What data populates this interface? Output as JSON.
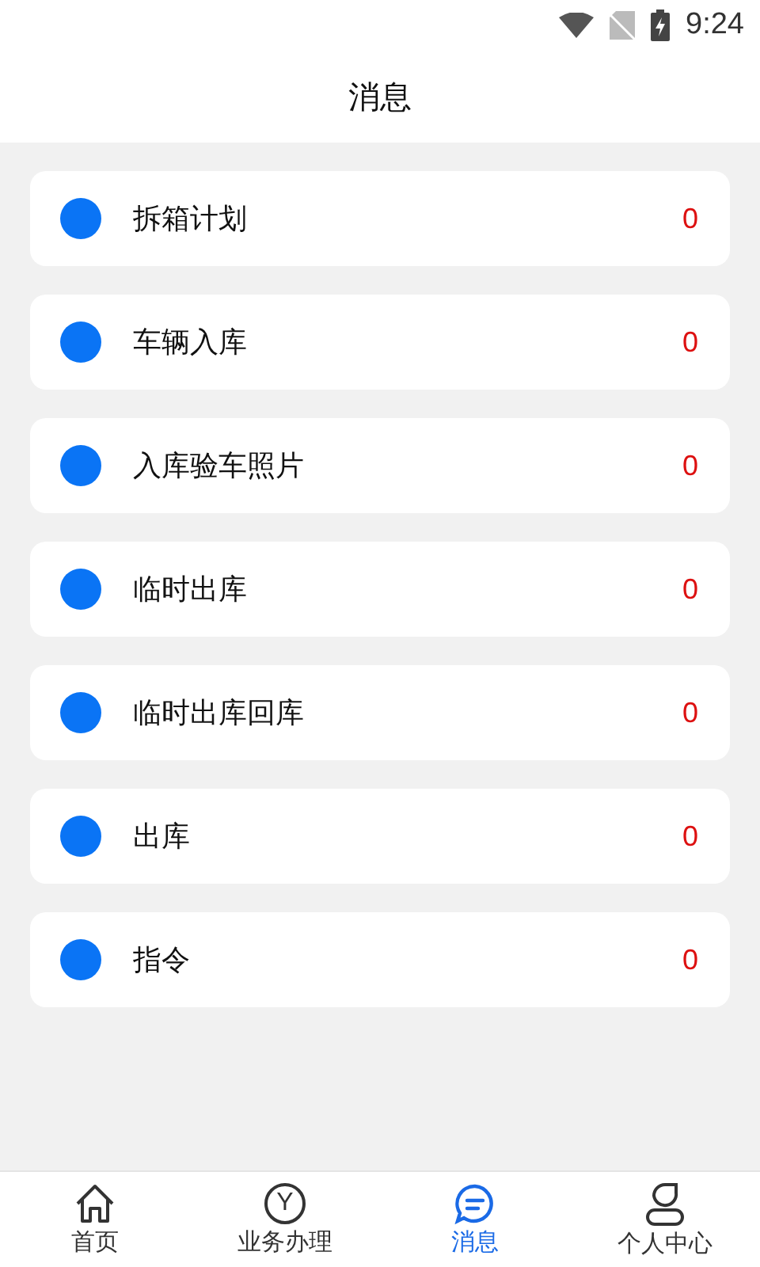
{
  "status_bar": {
    "time": "9:24"
  },
  "header": {
    "title": "消息"
  },
  "messages": [
    {
      "name": "拆箱计划",
      "count": "0",
      "color": "#0a74f5"
    },
    {
      "name": "车辆入库",
      "count": "0",
      "color": "#0a74f5"
    },
    {
      "name": "入库验车照片",
      "count": "0",
      "color": "#0a74f5"
    },
    {
      "name": "临时出库",
      "count": "0",
      "color": "#0a74f5"
    },
    {
      "name": "临时出库回库",
      "count": "0",
      "color": "#0a74f5"
    },
    {
      "name": "出库",
      "count": "0",
      "color": "#0a74f5"
    },
    {
      "name": "指令",
      "count": "0",
      "color": "#0a74f5"
    }
  ],
  "tabs": [
    {
      "label": "首页",
      "kind": "home",
      "selected": false
    },
    {
      "label": "业务办理",
      "kind": "letter",
      "icon_text": "Y",
      "selected": false
    },
    {
      "label": "消息",
      "kind": "chat",
      "selected": true
    },
    {
      "label": "个人中心",
      "kind": "person",
      "selected": false
    }
  ]
}
